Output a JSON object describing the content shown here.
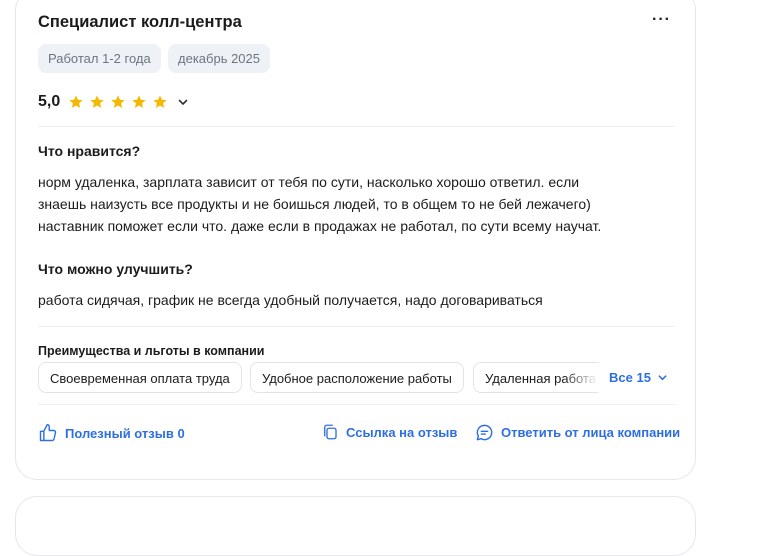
{
  "review": {
    "title": "Специалист колл-центра",
    "more_label": "···",
    "chips": [
      "Работал 1-2 года",
      "декабрь 2025"
    ],
    "rating": "5,0",
    "stars": 5,
    "pros_title": "Что нравится?",
    "pros_lines": [
      "норм удаленка, зарплата зависит от тебя по сути, насколько хорошо ответил. если",
      "знаешь наизусть все продукты и не боишься людей, то в общем то не бей лежачего)",
      "наставник поможет если что. даже если в продажах не работал, по сути всему научат."
    ],
    "cons_title": "Что можно улучшить?",
    "cons_text": "работа сидячая, график не всегда удобный получается, надо договариваться",
    "benefits_title": "Преимущества и льготы в компании",
    "benefits": [
      "Своевременная оплата труда",
      "Удобное расположение работы",
      "Удаленная работа"
    ],
    "all_benefits_label": "Все 15",
    "actions": {
      "helpful": "Полезный отзыв 0",
      "link": "Ссылка на отзыв",
      "reply": "Ответить от лица компании"
    }
  },
  "colors": {
    "accent": "#2e6fe0",
    "star": "#f5b800",
    "chip_bg": "#eef1f5"
  }
}
